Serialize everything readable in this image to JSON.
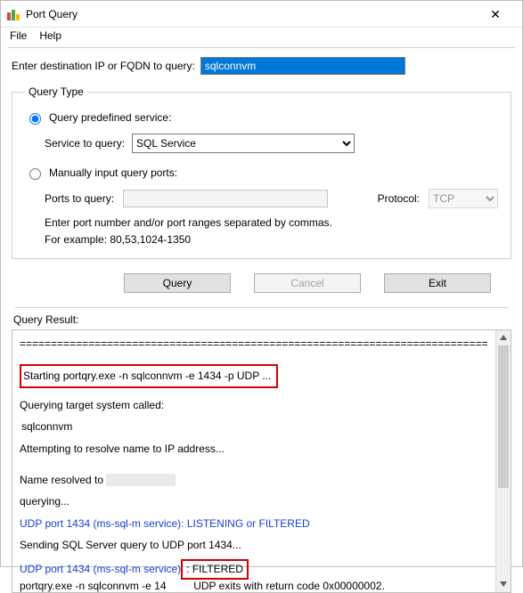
{
  "window": {
    "title": "Port Query"
  },
  "menu": {
    "file": "File",
    "help": "Help"
  },
  "dest": {
    "label": "Enter destination IP or FQDN to query:",
    "value": "sqlconnvm"
  },
  "queryType": {
    "legend": "Query Type",
    "predefinedLabel": "Query predefined service:",
    "serviceLabel": "Service to query:",
    "serviceValue": "SQL Service",
    "manualLabel": "Manually input query ports:",
    "portsLabel": "Ports to query:",
    "portsValue": "",
    "protocolLabel": "Protocol:",
    "protocolValue": "TCP",
    "hint1": "Enter port number and/or port ranges separated by commas.",
    "hint2": "For example: 80,53,1024-1350"
  },
  "buttons": {
    "query": "Query",
    "cancel": "Cancel",
    "exit": "Exit"
  },
  "result": {
    "label": "Query Result:",
    "eqline": "===========================================================================",
    "starting": "Starting portqry.exe -n sqlconnvm -e 1434 -p UDP ...",
    "queryingTarget": "Querying target system called:",
    "target": "sqlconnvm",
    "attempting": "Attempting to resolve name to IP address...",
    "resolvedPrefix": "Name resolved to ",
    "querying": "querying...",
    "udpListening": "UDP port 1434 (ms-sql-m service): LISTENING or FILTERED",
    "sending": "Sending SQL Server query to UDP port 1434...",
    "udpFilteredPrefix": "UDP port 1434 (ms-sql-m service)",
    "udpFilteredBox": ": FILTERED",
    "exitLinePre": "portqry.exe -n sqlconnvm -e 14",
    "exitLinePost": "UDP exits with return code 0x00000002."
  }
}
